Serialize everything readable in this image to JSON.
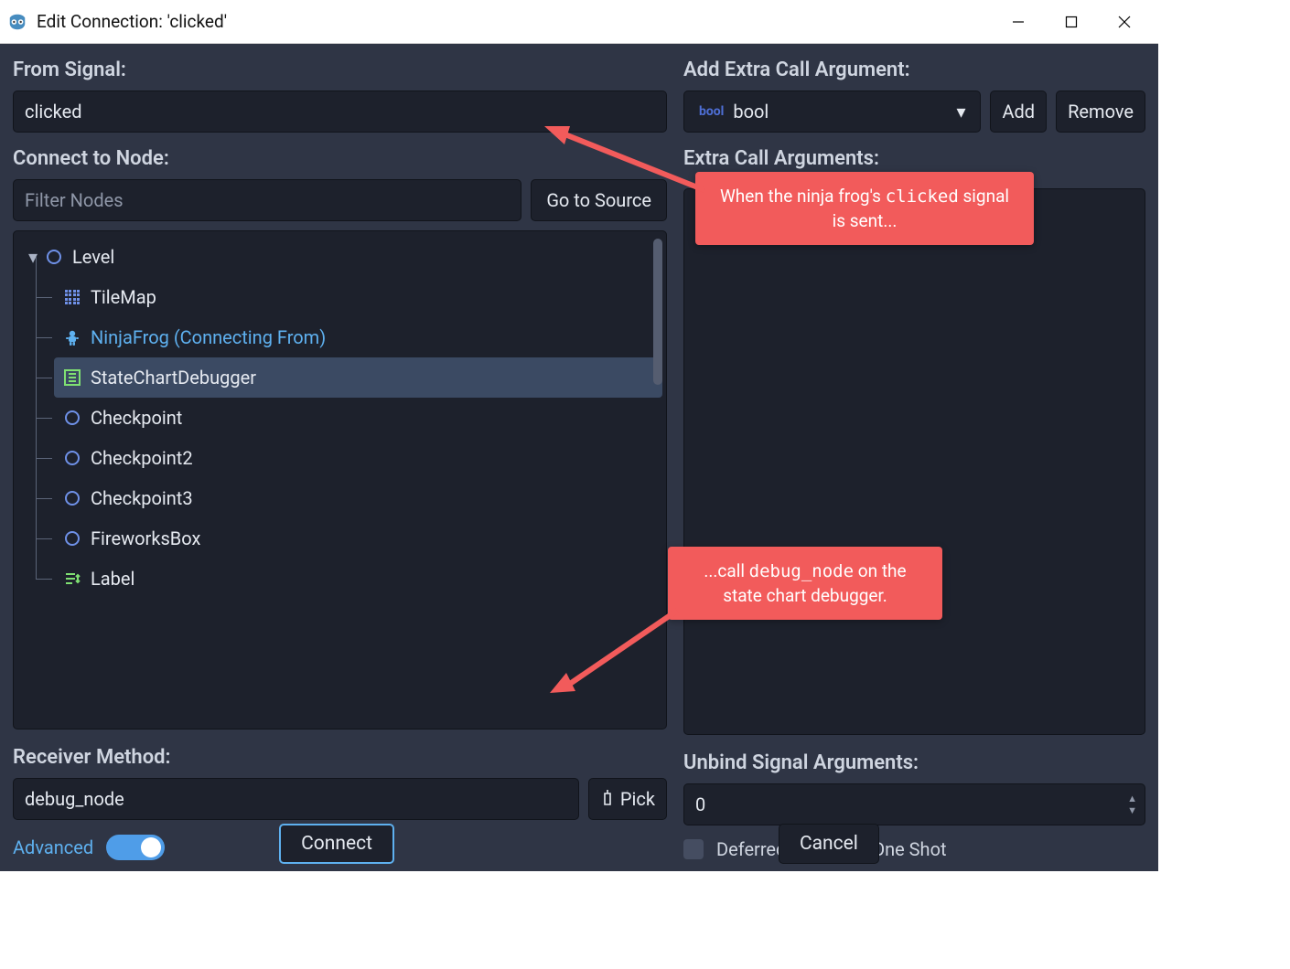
{
  "window": {
    "title": "Edit Connection: 'clicked'"
  },
  "left": {
    "from_signal_label": "From Signal:",
    "from_signal_value": "clicked",
    "connect_label": "Connect to Node:",
    "filter_placeholder": "Filter Nodes",
    "goto_source_label": "Go to Source",
    "receiver_label": "Receiver Method:",
    "receiver_value": "debug_node",
    "pick_label": "Pick",
    "advanced_label": "Advanced"
  },
  "tree": {
    "root": "Level",
    "items": [
      {
        "name": "TileMap",
        "icon": "grid"
      },
      {
        "name": "NinjaFrog (Connecting From)",
        "icon": "frog",
        "source": true
      },
      {
        "name": "StateChartDebugger",
        "icon": "sc",
        "selected": true
      },
      {
        "name": "Checkpoint",
        "icon": "ring"
      },
      {
        "name": "Checkpoint2",
        "icon": "ring"
      },
      {
        "name": "Checkpoint3",
        "icon": "ring"
      },
      {
        "name": "FireworksBox",
        "icon": "ring"
      },
      {
        "name": "Label",
        "icon": "label"
      }
    ]
  },
  "right": {
    "add_arg_label": "Add Extra Call Argument:",
    "type_value": "bool",
    "add_label": "Add",
    "remove_label": "Remove",
    "extra_args_label": "Extra Call Arguments:",
    "unbind_label": "Unbind Signal Arguments:",
    "unbind_value": "0",
    "deferred_label": "Deferred",
    "oneshot_label": "One Shot"
  },
  "footer": {
    "connect_label": "Connect",
    "cancel_label": "Cancel"
  },
  "annotations": {
    "top_pre": "When the ninja frog's ",
    "top_code": "clicked",
    "top_post": " signal is sent...",
    "bottom_pre": "...call ",
    "bottom_code": "debug_node",
    "bottom_post": " on the state chart debugger."
  }
}
